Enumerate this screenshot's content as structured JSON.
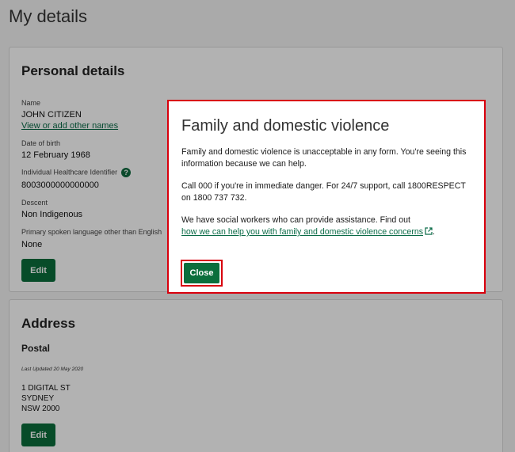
{
  "page": {
    "title": "My details"
  },
  "personal": {
    "heading": "Personal details",
    "name_label": "Name",
    "name_value": "JOHN CITIZEN",
    "other_names_link": "View or add other names",
    "dob_label": "Date of birth",
    "dob_value": "12 February 1968",
    "ihi_label": "Individual Healthcare Identifier",
    "ihi_value": "8003000000000000",
    "descent_label": "Descent",
    "descent_value": "Non Indigenous",
    "language_label": "Primary spoken language other than English",
    "language_value": "None",
    "edit_label": "Edit"
  },
  "address": {
    "heading": "Address",
    "postal_heading": "Postal",
    "last_updated": "Last Updated 20 May 2020",
    "lines": [
      "1 DIGITAL ST",
      "SYDNEY",
      "NSW 2000"
    ],
    "edit_label": "Edit"
  },
  "modal": {
    "title": "Family and domestic violence",
    "para1": "Family and domestic violence is unacceptable in any form. You're seeing this information because we can help.",
    "para2": "Call 000 if you're in immediate danger. For 24/7 support, call 1800RESPECT on 1800 737 732.",
    "para3_text": "We have social workers who can provide assistance. Find out",
    "para3_link": "how we can help you with family and domestic violence concerns",
    "para3_end": ".",
    "close_label": "Close"
  },
  "icons": {
    "help": "help-circle-icon",
    "external": "external-link-icon"
  },
  "colors": {
    "brand_green": "#0b6e3c",
    "link_green": "#0a6b47",
    "highlight_red": "#d8000c"
  }
}
